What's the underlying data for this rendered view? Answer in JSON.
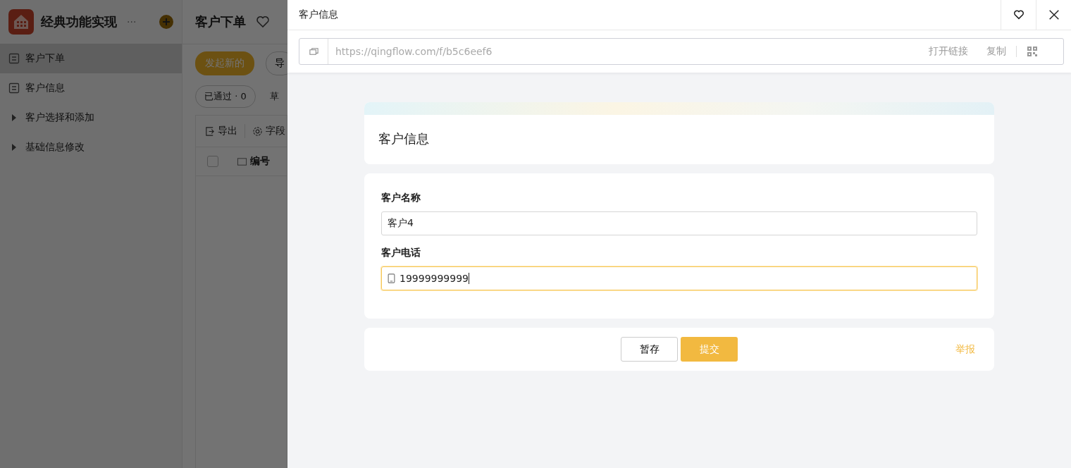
{
  "app": {
    "title": "经典功能实现",
    "more": "···"
  },
  "sidebar": {
    "items": [
      {
        "label": "客户下单",
        "kind": "page",
        "selected": true
      },
      {
        "label": "客户信息",
        "kind": "page",
        "selected": false
      },
      {
        "label": "客户选择和添加",
        "kind": "group",
        "selected": false
      },
      {
        "label": "基础信息修改",
        "kind": "group",
        "selected": false
      }
    ]
  },
  "main": {
    "title": "客户下单",
    "new_button": "发起新的",
    "import_button": "导",
    "filters": [
      "已通过 · 0",
      "草"
    ],
    "table_toolbar": [
      "导出",
      "字段"
    ],
    "columns": [
      "编号"
    ],
    "select_all_checked": false
  },
  "drawer": {
    "title": "客户信息",
    "url": "https://qingflow.com/f/b5c6eef6",
    "open_link": "打开链接",
    "copy": "复制"
  },
  "form": {
    "title": "客户信息",
    "fields": [
      {
        "label": "客户名称",
        "value": "客户4",
        "kind": "text",
        "focused": false
      },
      {
        "label": "客户电话",
        "value": "19999999999",
        "kind": "phone",
        "focused": true
      }
    ],
    "save_button": "暂存",
    "submit_button": "提交",
    "report_link": "举报"
  }
}
